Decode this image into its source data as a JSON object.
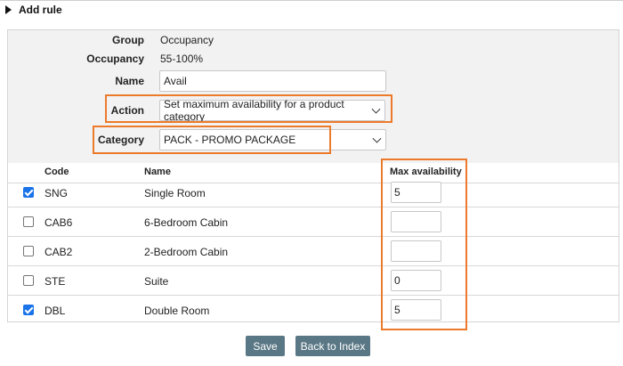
{
  "header": {
    "title": "Add rule"
  },
  "form": {
    "group_label": "Group",
    "group_value": "Occupancy",
    "occupancy_label": "Occupancy",
    "occupancy_value": "55-100%",
    "name_label": "Name",
    "name_value": "Avail",
    "action_label": "Action",
    "action_value": "Set maximum availability for a product category",
    "category_label": "Category",
    "category_value": "PACK - PROMO PACKAGE"
  },
  "table": {
    "columns": {
      "code": "Code",
      "name": "Name",
      "max": "Max availability"
    },
    "rows": [
      {
        "checked": true,
        "code": "SNG",
        "name": "Single Room",
        "max": "5"
      },
      {
        "checked": false,
        "code": "CAB6",
        "name": "6-Bedroom Cabin",
        "max": ""
      },
      {
        "checked": false,
        "code": "CAB2",
        "name": "2-Bedroom Cabin",
        "max": ""
      },
      {
        "checked": false,
        "code": "STE",
        "name": "Suite",
        "max": "0"
      },
      {
        "checked": true,
        "code": "DBL",
        "name": "Double Room",
        "max": "5"
      }
    ]
  },
  "buttons": {
    "save": "Save",
    "back": "Back to Index"
  },
  "colors": {
    "highlight": "#ec7a2b",
    "button_bg": "#5a7785",
    "checkbox_on": "#1a73e8"
  }
}
